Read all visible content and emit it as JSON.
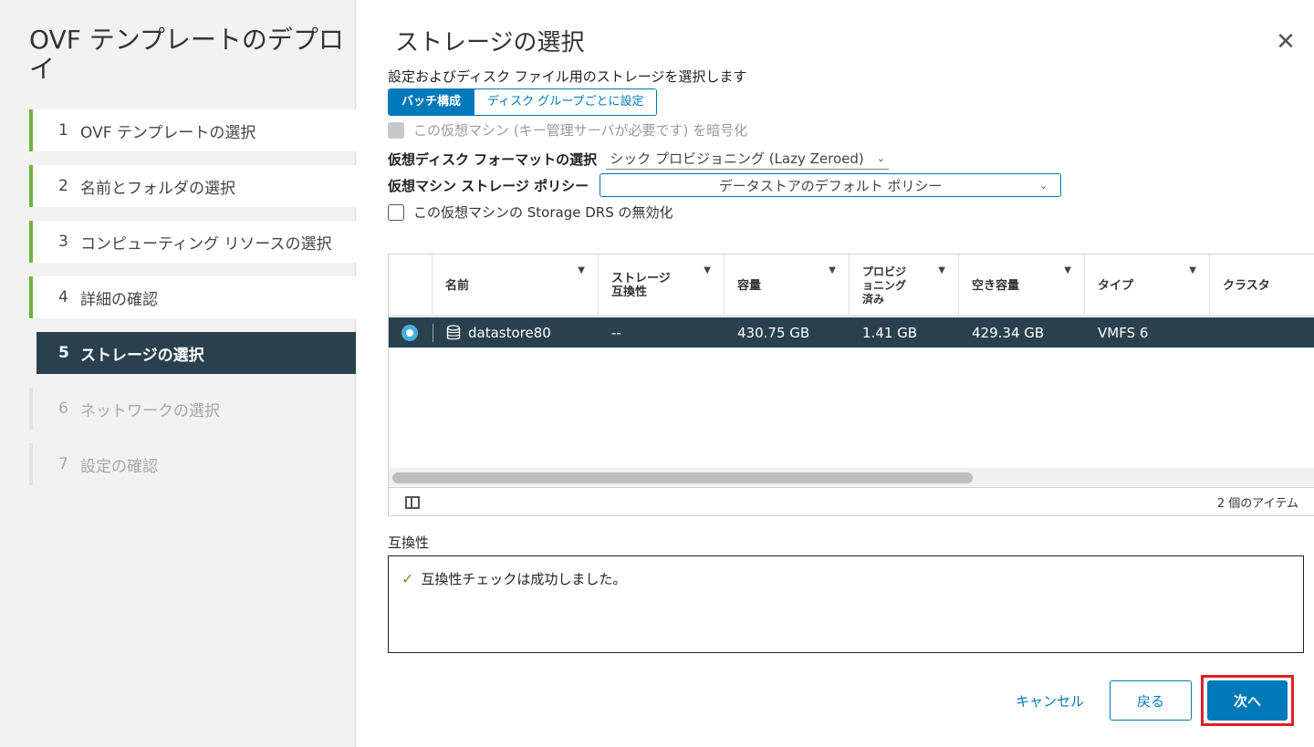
{
  "wizard": {
    "title": "OVF テンプレートのデプロイ",
    "steps": [
      {
        "num": "1",
        "label": "OVF テンプレートの選択",
        "state": "done"
      },
      {
        "num": "2",
        "label": "名前とフォルダの選択",
        "state": "done"
      },
      {
        "num": "3",
        "label": "コンピューティング リソースの選択",
        "state": "done"
      },
      {
        "num": "4",
        "label": "詳細の確認",
        "state": "done"
      },
      {
        "num": "5",
        "label": "ストレージの選択",
        "state": "current"
      },
      {
        "num": "6",
        "label": "ネットワークの選択",
        "state": "future"
      },
      {
        "num": "7",
        "label": "設定の確認",
        "state": "future"
      }
    ]
  },
  "page": {
    "title": "ストレージの選択",
    "subtitle": "設定およびディスク ファイル用のストレージを選択します",
    "close_icon": "close-icon"
  },
  "segment": {
    "batch": "バッチ構成",
    "per_group": "ディスク グループごとに設定"
  },
  "encrypt": {
    "label": "この仮想マシン (キー管理サーバが必要です) を暗号化",
    "checked": false,
    "disabled": true
  },
  "disk_format": {
    "label": "仮想ディスク フォーマットの選択",
    "value": "シック プロビジョニング (Lazy Zeroed)"
  },
  "storage_policy": {
    "label": "仮想マシン ストレージ ポリシー",
    "value": "データストアのデフォルト ポリシー"
  },
  "drs": {
    "label": "この仮想マシンの Storage DRS の無効化",
    "checked": false
  },
  "grid": {
    "columns": [
      "名前",
      "ストレージ\n互換性",
      "容量",
      "プロビジ\nョニング\n済み",
      "空き容量",
      "タイプ",
      "クラスタ"
    ],
    "rows": [
      {
        "name": "datastore80",
        "compat": "--",
        "capacity": "430.75 GB",
        "provisioned": "1.41 GB",
        "free": "429.34 GB",
        "type": "VMFS 6",
        "cluster": ""
      }
    ],
    "item_count": "2 個のアイテム"
  },
  "compatibility": {
    "label": "互換性",
    "message": "互換性チェックは成功しました。"
  },
  "footer": {
    "cancel": "キャンセル",
    "back": "戻る",
    "next": "次へ"
  },
  "colors": {
    "accent": "#0079b8",
    "selected_row": "#29414e",
    "done_bar": "#6db33f",
    "highlight": "#e0202a"
  }
}
